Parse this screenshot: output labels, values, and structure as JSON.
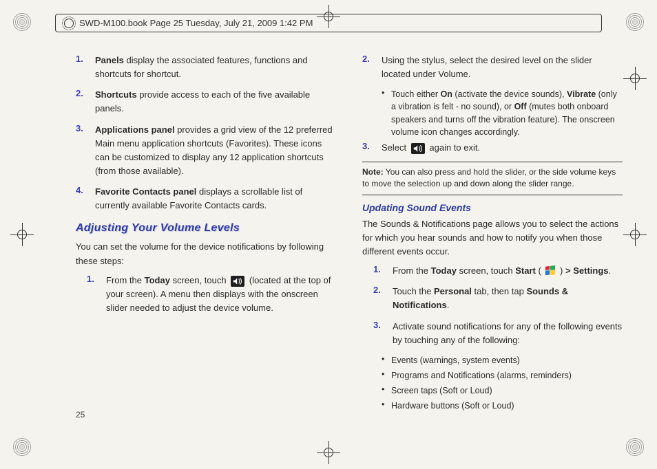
{
  "header": {
    "text": "SWD-M100.book  Page 25  Tuesday, July 21, 2009  1:42 PM"
  },
  "left": {
    "items": [
      {
        "n": "1.",
        "lead": "Panels",
        "rest": " display the associated features, functions and shortcuts for shortcut."
      },
      {
        "n": "2.",
        "lead": "Shortcuts",
        "rest": " provide access to each of the five available panels."
      },
      {
        "n": "3.",
        "lead": "Applications panel",
        "rest": " provides a grid view of the 12 preferred Main menu application shortcuts (Favorites). These icons can be customized to display any 12 application shortcuts (from those available)."
      },
      {
        "n": "4.",
        "lead": "Favorite Contacts panel",
        "rest": " displays a scrollable list of currently available Favorite Contacts cards."
      }
    ],
    "heading": "Adjusting Your Volume Levels",
    "intro": "You can set the volume for the device notifications by following these steps:",
    "step1": {
      "n": "1.",
      "pre": "From the ",
      "today": "Today",
      "mid": " screen, touch ",
      "post": " (located at the top of your screen). A menu then displays with the onscreen slider needed to adjust the device volume."
    }
  },
  "right": {
    "step2": {
      "n": "2.",
      "text": "Using the stylus, select the desired level on the slider located under Volume."
    },
    "bullet2a": {
      "pre": "Touch either ",
      "on": "On",
      "mid1": " (activate the device sounds), ",
      "vib": "Vibrate",
      "mid2": " (only a vibration is felt - no sound), or ",
      "off": "Off",
      "post": " (mutes both onboard speakers and turns off the vibration feature). The onscreen volume icon changes accordingly."
    },
    "step3": {
      "n": "3.",
      "pre": "Select ",
      "post": " again to exit."
    },
    "note": {
      "lead": "Note:",
      "rest": " You can also press and hold the slider, or the side volume keys to move the selection up and down along the slider range."
    },
    "subheading": "Updating Sound Events",
    "subintro": "The Sounds & Notifications page allows you to select the actions for which you hear sounds and how to notify you when those different events occur.",
    "s1": {
      "n": "1.",
      "pre": "From the ",
      "today": "Today",
      "mid": " screen, touch ",
      "start": "Start",
      "paren_open": " ( ",
      "paren_close": " ) ",
      "gt": "> ",
      "settings": "Settings",
      "end": "."
    },
    "s2": {
      "n": "2.",
      "pre": "Touch the ",
      "personal": "Personal",
      "mid": " tab, then tap ",
      "sn": "Sounds & Notifications",
      "end": "."
    },
    "s3": {
      "n": "3.",
      "text": "Activate sound notifications for any of the following events by touching any of the following:"
    },
    "bullets": [
      "Events (warnings, system events)",
      "Programs and Notifications (alarms, reminders)",
      "Screen taps (Soft or Loud)",
      "Hardware buttons (Soft or Loud)"
    ]
  },
  "page_number": "25"
}
